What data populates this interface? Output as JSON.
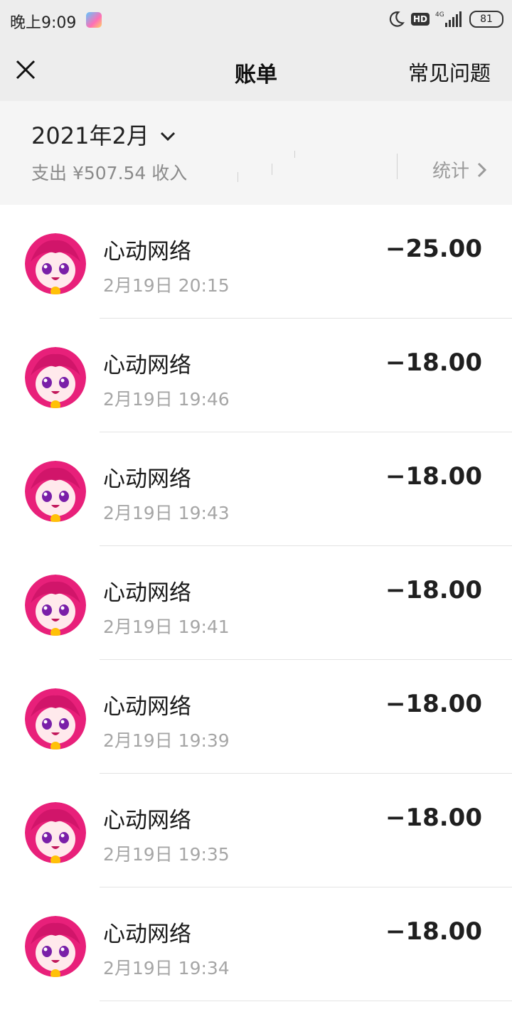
{
  "status_bar": {
    "time": "晚上9:09",
    "hd": "HD",
    "network": "4G",
    "battery": "81"
  },
  "header": {
    "title": "账单",
    "faq_label": "常见问题"
  },
  "summary": {
    "month": "2021年2月",
    "totals": "支出 ¥507.54 收入",
    "stats_label": "统计"
  },
  "transactions": [
    {
      "merchant": "心动网络",
      "time": "2月19日 20:15",
      "amount": "−25.00"
    },
    {
      "merchant": "心动网络",
      "time": "2月19日 19:46",
      "amount": "−18.00"
    },
    {
      "merchant": "心动网络",
      "time": "2月19日 19:43",
      "amount": "−18.00"
    },
    {
      "merchant": "心动网络",
      "time": "2月19日 19:41",
      "amount": "−18.00"
    },
    {
      "merchant": "心动网络",
      "time": "2月19日 19:39",
      "amount": "−18.00"
    },
    {
      "merchant": "心动网络",
      "time": "2月19日 19:35",
      "amount": "−18.00"
    },
    {
      "merchant": "心动网络",
      "time": "2月19日 19:34",
      "amount": "−18.00"
    }
  ],
  "icons": {
    "close": "close-icon",
    "month_dropdown": "chevron-down-icon",
    "stats": "chevron-right-icon",
    "avatar": "anime-avatar-icon"
  },
  "colors": {
    "header_bg": "#ededed",
    "summary_bg": "#f5f5f5",
    "avatar_primary": "#e8207a"
  }
}
